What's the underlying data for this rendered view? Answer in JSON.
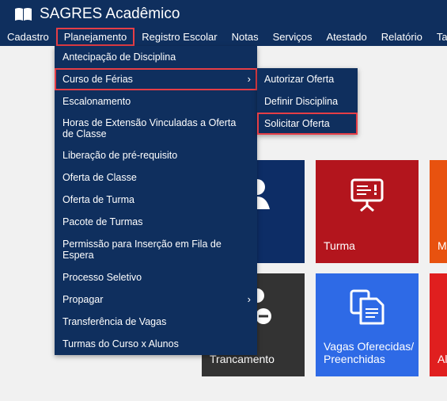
{
  "app": {
    "title": "SAGRES Acadêmico",
    "logo_icon": "book-icon"
  },
  "menu": [
    "Cadastro",
    "Planejamento",
    "Registro Escolar",
    "Notas",
    "Serviços",
    "Atestado",
    "Relatório",
    "Tabela"
  ],
  "dropdown": {
    "items": [
      "Antecipação de Disciplina",
      "Curso de Férias",
      "Escalonamento",
      "Horas de Extensão Vinculadas a Oferta de Classe",
      "Liberação de pré-requisito",
      "Oferta de Classe",
      "Oferta de Turma",
      "Pacote de Turmas",
      "Permissão para Inserção em Fila de Espera",
      "Processo Seletivo",
      "Propagar",
      "Transferência de Vagas",
      "Turmas do Curso x Alunos"
    ],
    "submenu_caret": "›"
  },
  "submenu": {
    "items": [
      "Autorizar Oferta",
      "Definir Disciplina",
      "Solicitar Oferta"
    ]
  },
  "tiles": {
    "turma": {
      "label": "Turma",
      "icon": "presentation-board-icon"
    },
    "orange_partial": {
      "label": "M"
    },
    "trancamento": {
      "label": "Trancamento"
    },
    "vagas": {
      "label_line1": "Vagas Oferecidas/",
      "label_line2": "Preenchidas",
      "icon": "documents-icon"
    },
    "red_partial": {
      "label": "Al"
    }
  },
  "colors": {
    "header": "#0f2f5e",
    "highlight": "#e53e46",
    "tile_dark_blue": "#0d2d66",
    "tile_turma": "#b3151d",
    "tile_orange": "#e8520f",
    "tile_trancamento": "#333333",
    "tile_vagas": "#2e6ae6",
    "tile_red": "#e01f1f"
  }
}
